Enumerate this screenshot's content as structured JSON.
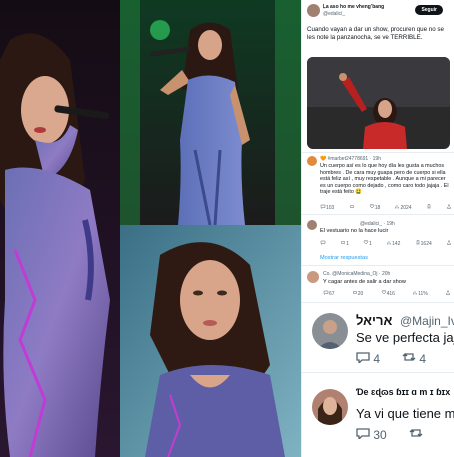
{
  "colors": {
    "accent": "#1d9bf0",
    "text": "#0f1419",
    "muted": "#536471",
    "follow_bg": "#0f1419",
    "link": "#1d9bf0"
  },
  "photos": [
    {
      "name": "singer-microphone-photo"
    },
    {
      "name": "singer-stage-photo"
    },
    {
      "name": "singer-closeup-photo"
    }
  ],
  "tweet": {
    "display_name": "Ꮮa aso ho me vhengʼbang",
    "handle": "@edalici_",
    "follow_label": "Seguir",
    "text": "Cuando vayan a dar un show, procuren que no se les note la panzanocha, se ve TERRIBLE.",
    "media_icon": "photo-icon"
  },
  "replies": [
    {
      "user": "🧡 #marbet24778691 · 19h",
      "text": "Un cuerpo así es lo que hoy día les gusta a muchos hombres . De cara muy guapa pero de cuerpo si ella está feliz así , muy respetable . Aunque a mi parecer es un cuerpo como dejado , como caro todo jajaja . El traje está feito 🤮",
      "stats": [
        "103",
        "18",
        "2024",
        "1"
      ]
    },
    {
      "user": "@edalici_ · 19h",
      "text": "El vestuario no la hace lucir",
      "stats": [
        "1",
        "1",
        "142",
        "1624"
      ]
    }
  ],
  "show_more": "Mostrar respuestas",
  "reply3": {
    "user": "Co. @MonicaMedina_Oj · 20h",
    "text": "Y cagar antes de salir a dar show",
    "stats": [
      "67",
      "20",
      "416",
      "11%"
    ]
  },
  "comment1": {
    "name": "אריאל",
    "handle": "@Majin_Iva",
    "text": "Se ve perfecta jaj",
    "replies": "4",
    "retweets": "4"
  },
  "comment2": {
    "name": "Ɗe ɛɖɷs ɓɪɪ ɑ m ɪ ɓɪx",
    "text": "Ya vi que tiene mu",
    "replies": "30"
  }
}
